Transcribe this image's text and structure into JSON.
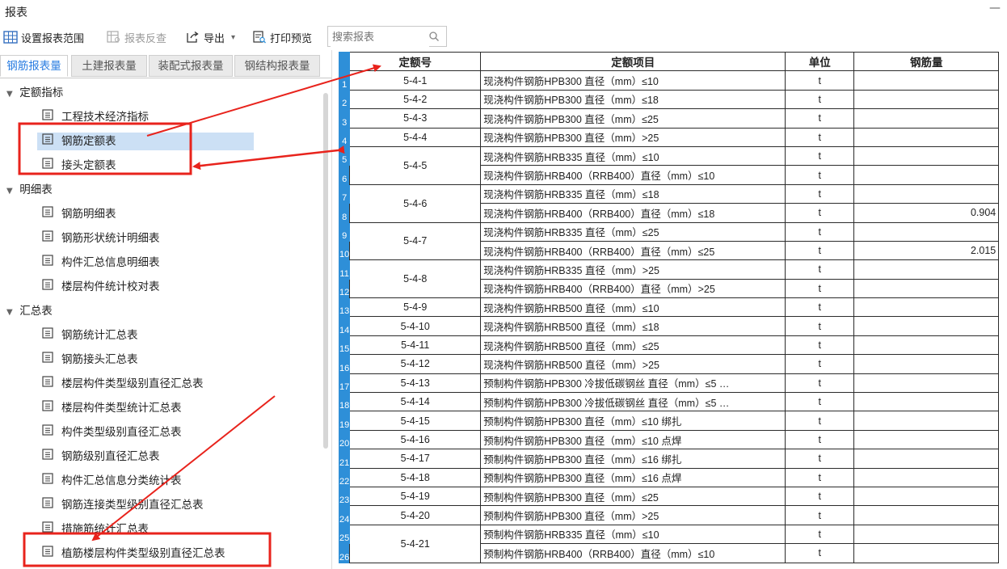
{
  "window": {
    "title": "报表",
    "minimize_glyph": "—"
  },
  "toolbar": {
    "set_range": "设置报表范围",
    "reverse_check": "报表反查",
    "export": "导出",
    "export_caret": "▾",
    "print_preview": "打印预览",
    "search_placeholder": "搜索报表"
  },
  "tabs": [
    "钢筋报表量",
    "土建报表量",
    "装配式报表量",
    "钢结构报表量"
  ],
  "tree": {
    "groups": [
      {
        "label": "定额指标",
        "items": [
          "工程技术经济指标",
          "钢筋定额表",
          "接头定额表"
        ]
      },
      {
        "label": "明细表",
        "items": [
          "钢筋明细表",
          "钢筋形状统计明细表",
          "构件汇总信息明细表",
          "楼层构件统计校对表"
        ]
      },
      {
        "label": "汇总表",
        "items": [
          "钢筋统计汇总表",
          "钢筋接头汇总表",
          "楼层构件类型级别直径汇总表",
          "楼层构件类型统计汇总表",
          "构件类型级别直径汇总表",
          "钢筋级别直径汇总表",
          "构件汇总信息分类统计表",
          "钢筋连接类型级别直径汇总表",
          "措施筋统计汇总表",
          "植筋楼层构件类型级别直径汇总表"
        ]
      }
    ],
    "selected": "钢筋定额表"
  },
  "table": {
    "headers": [
      "定额号",
      "定额项目",
      "单位",
      "钢筋量"
    ],
    "rows": [
      {
        "n": "1",
        "code": "5-4-1",
        "item": "现浇构件钢筋HPB300 直径（mm）≤10",
        "unit": "t",
        "amt": ""
      },
      {
        "n": "2",
        "code": "5-4-2",
        "item": "现浇构件钢筋HPB300 直径（mm）≤18",
        "unit": "t",
        "amt": ""
      },
      {
        "n": "3",
        "code": "5-4-3",
        "item": "现浇构件钢筋HPB300 直径（mm）≤25",
        "unit": "t",
        "amt": ""
      },
      {
        "n": "4",
        "code": "5-4-4",
        "item": "现浇构件钢筋HPB300 直径（mm）>25",
        "unit": "t",
        "amt": ""
      },
      {
        "n": "5",
        "code": "5-4-5",
        "item": "现浇构件钢筋HRB335 直径（mm）≤10",
        "unit": "t",
        "amt": ""
      },
      {
        "n": "6",
        "code": "",
        "item": "现浇构件钢筋HRB400（RRB400）直径（mm）≤10",
        "unit": "t",
        "amt": ""
      },
      {
        "n": "7",
        "code": "5-4-6",
        "item": "现浇构件钢筋HRB335 直径（mm）≤18",
        "unit": "t",
        "amt": ""
      },
      {
        "n": "8",
        "code": "",
        "item": "现浇构件钢筋HRB400（RRB400）直径（mm）≤18",
        "unit": "t",
        "amt": "0.904"
      },
      {
        "n": "9",
        "code": "5-4-7",
        "item": "现浇构件钢筋HRB335 直径（mm）≤25",
        "unit": "t",
        "amt": ""
      },
      {
        "n": "10",
        "code": "",
        "item": "现浇构件钢筋HRB400（RRB400）直径（mm）≤25",
        "unit": "t",
        "amt": "2.015"
      },
      {
        "n": "11",
        "code": "5-4-8",
        "item": "现浇构件钢筋HRB335 直径（mm）>25",
        "unit": "t",
        "amt": ""
      },
      {
        "n": "12",
        "code": "",
        "item": "现浇构件钢筋HRB400（RRB400）直径（mm）>25",
        "unit": "t",
        "amt": ""
      },
      {
        "n": "13",
        "code": "5-4-9",
        "item": "现浇构件钢筋HRB500 直径（mm）≤10",
        "unit": "t",
        "amt": ""
      },
      {
        "n": "14",
        "code": "5-4-10",
        "item": "现浇构件钢筋HRB500 直径（mm）≤18",
        "unit": "t",
        "amt": ""
      },
      {
        "n": "15",
        "code": "5-4-11",
        "item": "现浇构件钢筋HRB500 直径（mm）≤25",
        "unit": "t",
        "amt": ""
      },
      {
        "n": "16",
        "code": "5-4-12",
        "item": "现浇构件钢筋HRB500 直径（mm）>25",
        "unit": "t",
        "amt": ""
      },
      {
        "n": "17",
        "code": "5-4-13",
        "item": "预制构件钢筋HPB300 冷拔低碳钢丝 直径（mm）≤5 …",
        "unit": "t",
        "amt": ""
      },
      {
        "n": "18",
        "code": "5-4-14",
        "item": "预制构件钢筋HPB300 冷拔低碳钢丝 直径（mm）≤5 …",
        "unit": "t",
        "amt": ""
      },
      {
        "n": "19",
        "code": "5-4-15",
        "item": "预制构件钢筋HPB300 直径（mm）≤10 绑扎",
        "unit": "t",
        "amt": ""
      },
      {
        "n": "20",
        "code": "5-4-16",
        "item": "预制构件钢筋HPB300 直径（mm）≤10 点焊",
        "unit": "t",
        "amt": ""
      },
      {
        "n": "21",
        "code": "5-4-17",
        "item": "预制构件钢筋HPB300 直径（mm）≤16 绑扎",
        "unit": "t",
        "amt": ""
      },
      {
        "n": "22",
        "code": "5-4-18",
        "item": "预制构件钢筋HPB300 直径（mm）≤16 点焊",
        "unit": "t",
        "amt": ""
      },
      {
        "n": "23",
        "code": "5-4-19",
        "item": "预制构件钢筋HPB300 直径（mm）≤25",
        "unit": "t",
        "amt": ""
      },
      {
        "n": "24",
        "code": "5-4-20",
        "item": "预制构件钢筋HPB300 直径（mm）>25",
        "unit": "t",
        "amt": ""
      },
      {
        "n": "25",
        "code": "5-4-21",
        "item": "预制构件钢筋HRB335 直径（mm）≤10",
        "unit": "t",
        "amt": ""
      },
      {
        "n": "26",
        "code": "",
        "item": "预制构件钢筋HRB400（RRB400）直径（mm）≤10",
        "unit": "t",
        "amt": ""
      }
    ]
  },
  "colors": {
    "accent": "#2a7de1",
    "row_number_bg": "#2e8fd8",
    "selection_bg": "#cce0f5",
    "annotation_red": "#e8231c"
  }
}
